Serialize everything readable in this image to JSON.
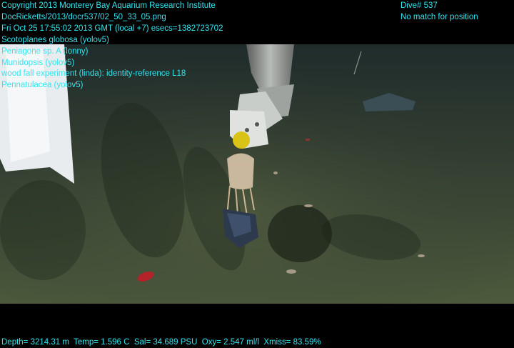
{
  "header": {
    "copyright": "Copyright 2013 Monterey Bay Aquarium Research Institute",
    "file_path": "DocRicketts/2013/docr537/02_50_33_05.png",
    "timestamp": "Fri Oct 25 17:55:02 2013 GMT (local +7)  esecs=1382723702",
    "dive": "Dive# 537",
    "position_status": "No match for position"
  },
  "annotations": [
    "Scotoplanes globosa (yolov5)",
    "Peniagone sp. A (lonny)",
    "Munidopsis (yolov5)",
    "wood fall experiment (linda): identity-reference L18",
    "Pennatulacea (yolov5)"
  ],
  "footer": {
    "depth": "Depth= 3214.31 m",
    "temp": "Temp= 1.596 C",
    "sal": "Sal= 34.689 PSU",
    "oxy": "Oxy= 2.547 ml/l",
    "xmiss": "Xmiss= 83.59%"
  },
  "colors": {
    "overlay_text": "#33e6ee",
    "seafloor": "#3d4a33",
    "letterbox": "#000000"
  }
}
